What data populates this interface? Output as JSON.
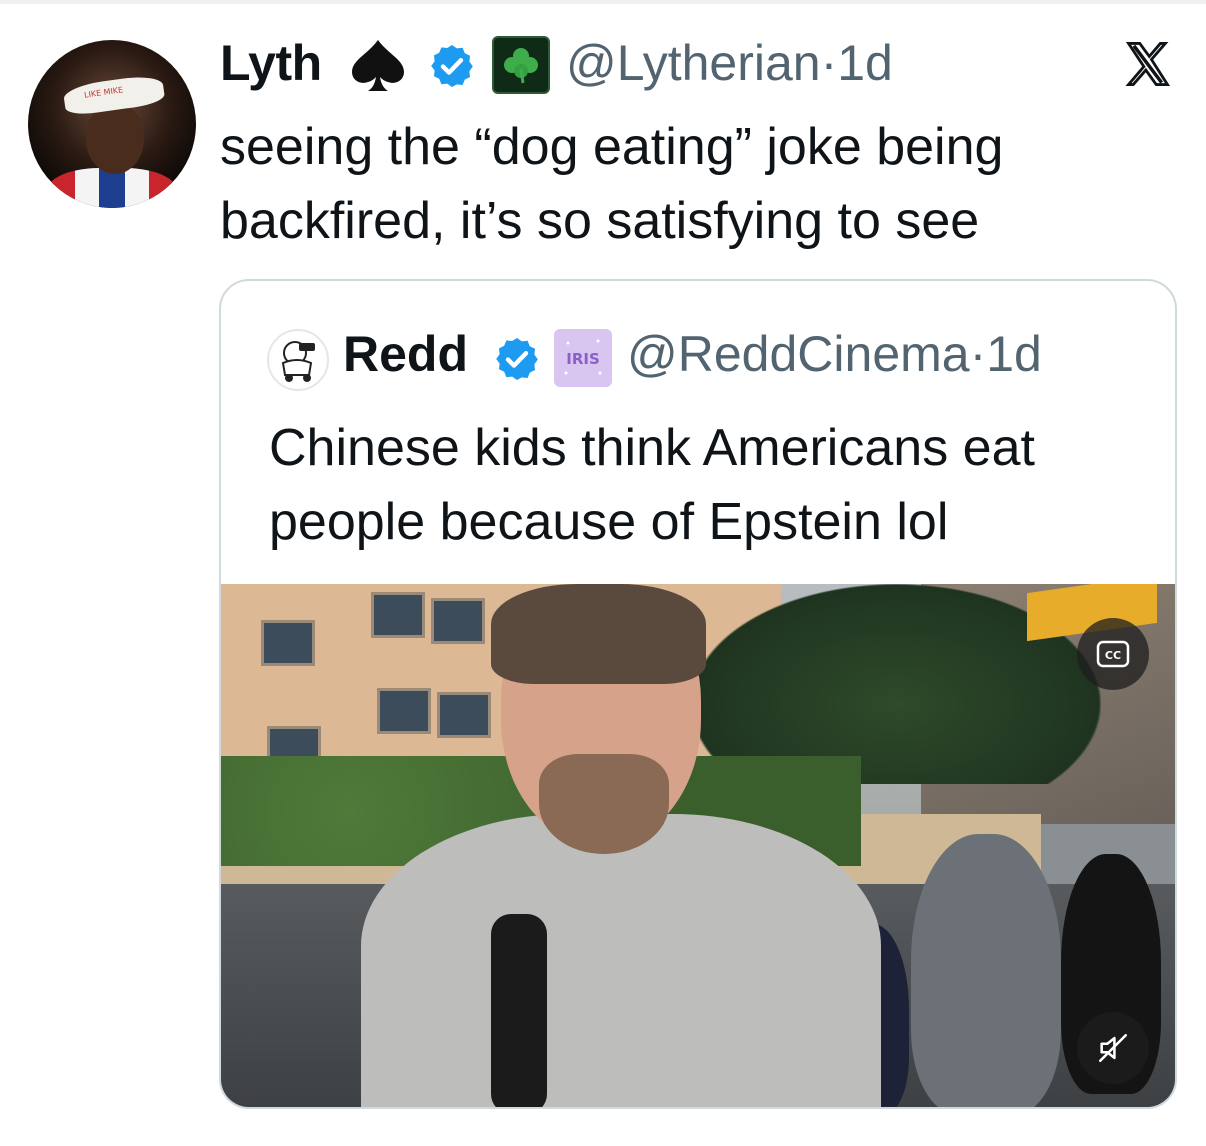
{
  "colors": {
    "text_primary": "#0f1419",
    "text_secondary": "#536471",
    "verified_blue": "#1d9bf0",
    "card_border": "#cfd9de"
  },
  "post": {
    "author_name": "Lyth",
    "handle": "@Lytherian",
    "separator": "·",
    "time": "1d",
    "text_lines": [
      "seeing the “dog eating” joke being",
      "backfired, it’s so satisfying to see"
    ],
    "badges": [
      "spade-icon",
      "verified-badge-icon",
      "clover-icon"
    ],
    "avatar_headband_text": "LIKE MIKE"
  },
  "quoted_post": {
    "author_name": "Redd",
    "handle": "@ReddCinema",
    "separator": "·",
    "time": "1d",
    "text_lines": [
      "Chinese kids think Americans eat",
      "people because of Epstein lol"
    ],
    "badges": [
      "verified-badge-icon",
      "iris-affiliate-icon"
    ],
    "affiliate_label": "IRIS",
    "media": {
      "type": "video",
      "cc_label": "CC",
      "mute_icon": "muted-speaker-icon"
    }
  },
  "platform_icon": "x-logo-icon"
}
